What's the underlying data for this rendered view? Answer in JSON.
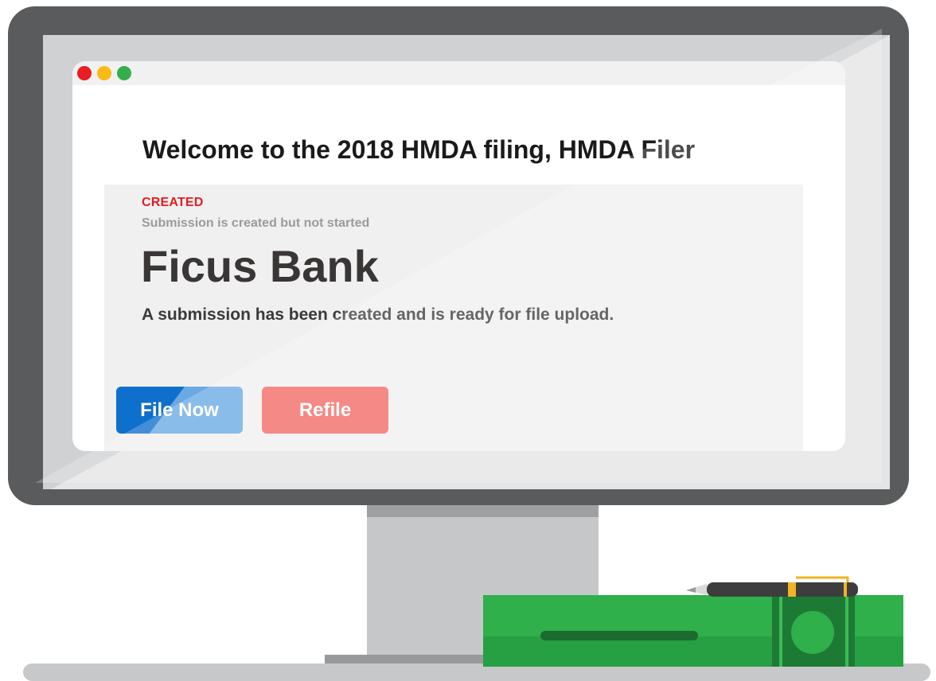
{
  "browser": {
    "window_controls": [
      "close-dot",
      "minimize-dot",
      "maximize-dot"
    ]
  },
  "page": {
    "welcome_heading": "Welcome to the 2018 HMDA filing, HMDA Filer"
  },
  "submission": {
    "status_label": "CREATED",
    "status_description": "Submission is created but not started",
    "institution_name": "Ficus Bank",
    "message": "A submission has been created and is ready for file upload."
  },
  "actions": {
    "file_now_label": "File Now",
    "refile_label": "Refile"
  },
  "colors": {
    "status_red": "#e31c23",
    "primary_blue": "#0f6fcc",
    "refile_red": "#f26864",
    "book_green": "#2fb04a"
  }
}
